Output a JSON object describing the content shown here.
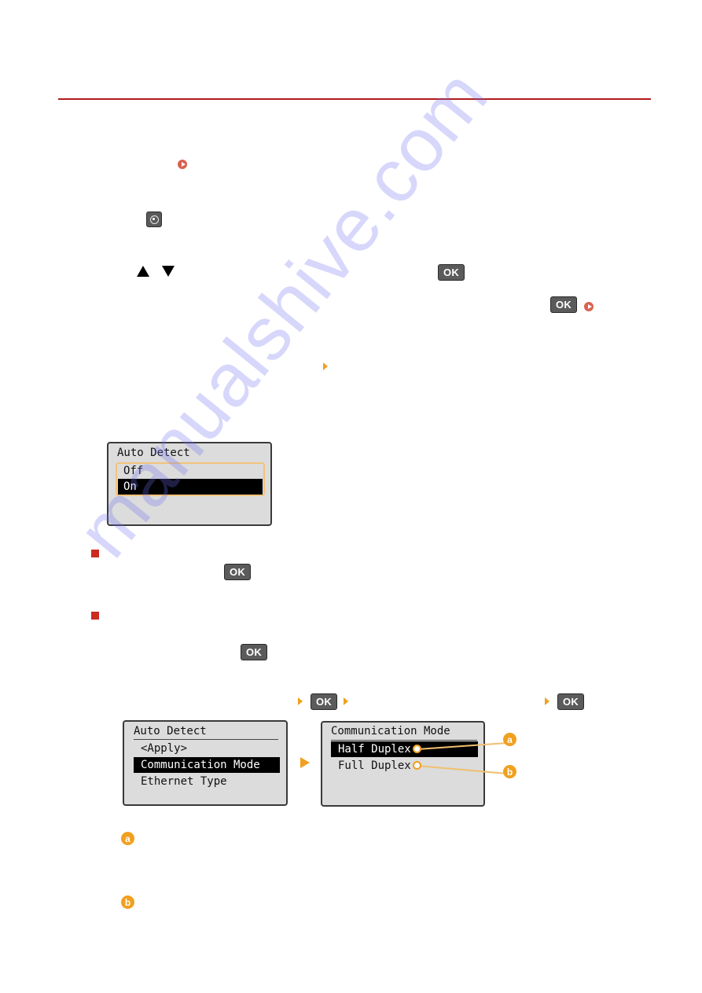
{
  "document": {
    "section_rule_color": "#b11b1b",
    "icons": {
      "link_icon": "link-arrow-icon",
      "menu_key": "menu-key-icon",
      "up_key": "up-arrow-key-icon",
      "down_key": "down-arrow-key-icon",
      "ok_key_label": "OK",
      "step_arrow": "step-arrow-icon",
      "section_bullet": "section-bullet-icon"
    },
    "ok_keys": [
      "OK",
      "OK",
      "OK",
      "OK",
      "OK",
      "OK"
    ],
    "lcd_auto_detect": {
      "title": "Auto Detect",
      "options": [
        {
          "label": "Off",
          "selected": false
        },
        {
          "label": "On",
          "selected": true
        }
      ]
    },
    "lcd_menu": {
      "title": "Auto Detect",
      "items": [
        {
          "label": "<Apply>",
          "selected": false
        },
        {
          "label": "Communication Mode",
          "selected": true
        },
        {
          "label": "Ethernet Type",
          "selected": false
        }
      ]
    },
    "lcd_comm_mode": {
      "title": "Communication Mode",
      "options": [
        {
          "label": "Half Duplex",
          "selected": true,
          "callout": "a"
        },
        {
          "label": "Full Duplex",
          "selected": false,
          "callout": "b"
        }
      ]
    },
    "callouts": [
      {
        "label": "a"
      },
      {
        "label": "b"
      }
    ],
    "colors": {
      "accent_orange": "#f0a020",
      "bullet_red": "#cc2b20",
      "link_red": "#d9624f",
      "ok_key_gray": "#5b5b5b"
    }
  },
  "watermark": {
    "text": "manualshive.com"
  }
}
